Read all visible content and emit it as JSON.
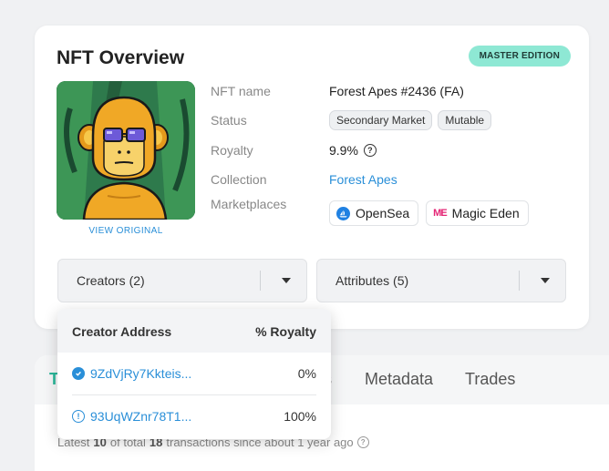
{
  "overview": {
    "title": "NFT Overview",
    "edition_badge": "MASTER EDITION",
    "view_original": "VIEW ORIGINAL",
    "fields": {
      "name_label": "NFT name",
      "name_value": "Forest Apes #2436 (FA)",
      "status_label": "Status",
      "status_tags": [
        "Secondary Market",
        "Mutable"
      ],
      "royalty_label": "Royalty",
      "royalty_value": "9.9%",
      "collection_label": "Collection",
      "collection_value": "Forest Apes",
      "marketplaces_label": "Marketplaces",
      "marketplaces": [
        "OpenSea",
        "Magic Eden"
      ]
    },
    "dropdowns": {
      "creators": "Creators (2)",
      "attributes": "Attributes (5)"
    }
  },
  "creators_popup": {
    "header_address": "Creator Address",
    "header_royalty": "% Royalty",
    "rows": [
      {
        "address": "9ZdVjRy7Kkteis...",
        "royalty": "0%",
        "icon": "verified-icon"
      },
      {
        "address": "93UqWZnr78T1...",
        "royalty": "100%",
        "icon": "unverified-icon"
      }
    ]
  },
  "tabs": {
    "first": "T",
    "partial": "s",
    "metadata": "Metadata",
    "trades": "Trades"
  },
  "transactions": {
    "prefix": "Latest",
    "shown": "10",
    "middle": "of total",
    "total": "18",
    "suffix": "transactions since about 1 year ago"
  }
}
